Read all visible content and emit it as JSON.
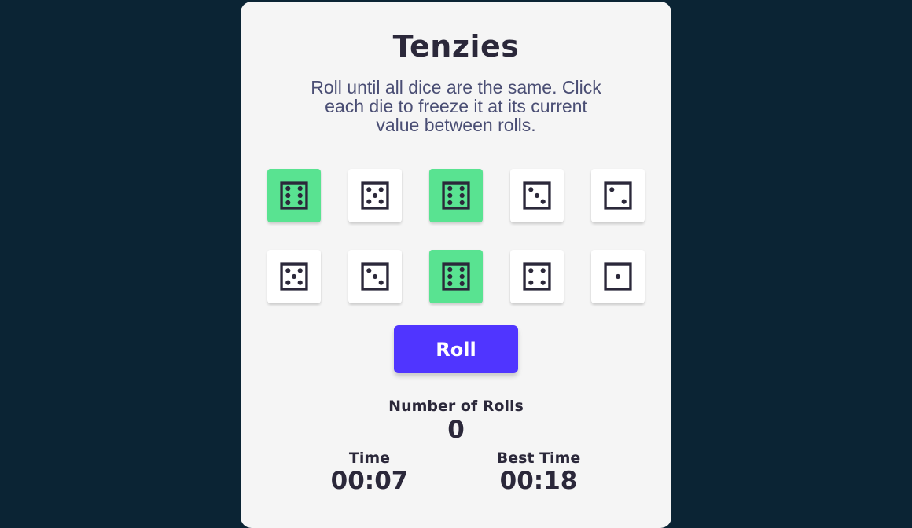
{
  "game": {
    "title": "Tenzies",
    "instructions": "Roll until all dice are the same. Click each die to freeze it at its current value between rolls."
  },
  "colors": {
    "background": "#0B2434",
    "card": "#F5F5F5",
    "held_die": "#59E391",
    "die": "#FFFFFF",
    "button": "#5035FF",
    "text": "#2B283A"
  },
  "dice": [
    {
      "value": 6,
      "held": true,
      "icon": "die-six-icon"
    },
    {
      "value": 5,
      "held": false,
      "icon": "die-five-icon"
    },
    {
      "value": 6,
      "held": true,
      "icon": "die-six-icon"
    },
    {
      "value": 3,
      "held": false,
      "icon": "die-three-icon"
    },
    {
      "value": 2,
      "held": false,
      "icon": "die-two-icon"
    },
    {
      "value": 5,
      "held": false,
      "icon": "die-five-icon"
    },
    {
      "value": 3,
      "held": false,
      "icon": "die-three-icon"
    },
    {
      "value": 6,
      "held": true,
      "icon": "die-six-icon"
    },
    {
      "value": 4,
      "held": false,
      "icon": "die-four-icon"
    },
    {
      "value": 1,
      "held": false,
      "icon": "die-one-icon"
    }
  ],
  "controls": {
    "roll_label": "Roll"
  },
  "stats": {
    "rolls_label": "Number of Rolls",
    "rolls_value": "0",
    "time_label": "Time",
    "time_value": "00:07",
    "best_label": "Best Time",
    "best_value": "00:18"
  }
}
